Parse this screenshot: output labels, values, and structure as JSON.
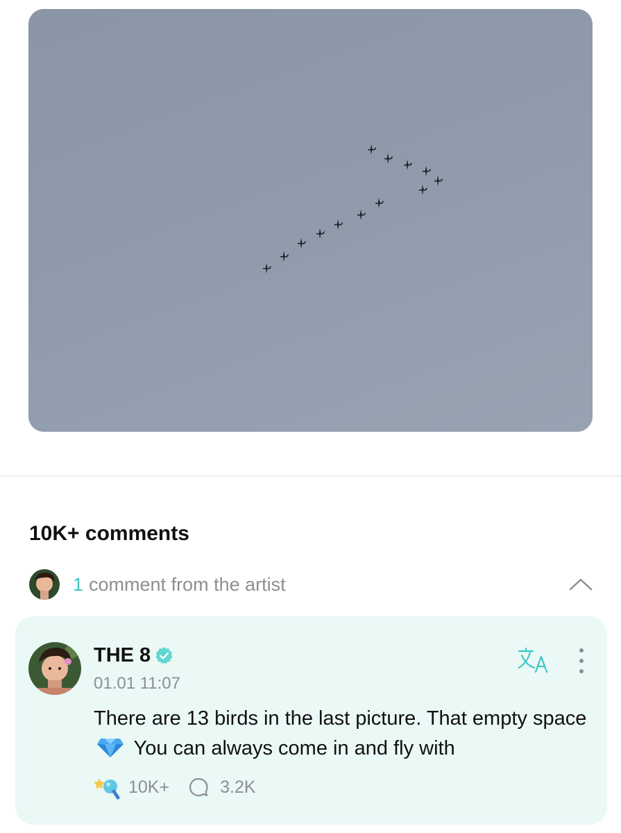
{
  "post": {
    "image_alt_icon": "bird-flock-photo"
  },
  "comments": {
    "count_label": "10K+ comments",
    "artist_section": {
      "count": "1",
      "label": "comment from the artist"
    }
  },
  "artist_comment": {
    "username": "THE 8",
    "timestamp": "01.01 11:07",
    "text_part1": "There are 13 birds in the last picture. That empty space",
    "text_part2": "You can always come in and fly with",
    "like_count": "10K+",
    "reply_count": "3.2K"
  },
  "colors": {
    "accent": "#3cc7c4",
    "card_background": "#eaf8f6",
    "secondary_text": "#8e8e93"
  }
}
